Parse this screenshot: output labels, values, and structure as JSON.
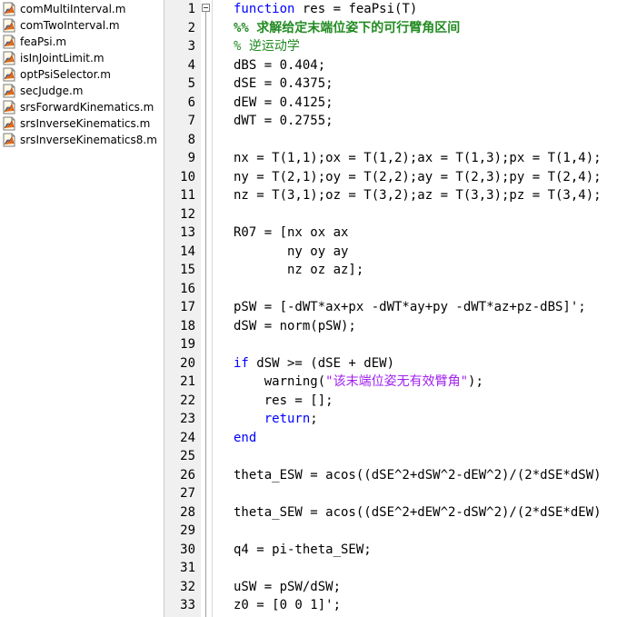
{
  "files": [
    {
      "name": "comMultiInterval.m",
      "icon": "matlab-file-icon"
    },
    {
      "name": "comTwoInterval.m",
      "icon": "matlab-file-icon"
    },
    {
      "name": "feaPsi.m",
      "icon": "matlab-file-icon"
    },
    {
      "name": "isInJointLimit.m",
      "icon": "matlab-file-icon"
    },
    {
      "name": "optPsiSelector.m",
      "icon": "matlab-file-icon"
    },
    {
      "name": "secJudge.m",
      "icon": "matlab-file-icon"
    },
    {
      "name": "srsForwardKinematics.m",
      "icon": "matlab-file-icon"
    },
    {
      "name": "srsInverseKinematics.m",
      "icon": "matlab-file-icon"
    },
    {
      "name": "srsInverseKinematics8.m",
      "icon": "matlab-file-icon"
    }
  ],
  "colors": {
    "keyword": "#0000ff",
    "comment": "#228b22",
    "string": "#a020f0",
    "gutter": "#f0f0f0"
  },
  "code_lines": [
    {
      "n": "1",
      "tokens": [
        {
          "t": "function",
          "c": "kw"
        },
        {
          "t": " res = feaPsi(T)",
          "c": ""
        }
      ]
    },
    {
      "n": "2",
      "tokens": [
        {
          "t": "%% 求解给定末端位姿下的可行臂角区间",
          "c": "cmb"
        }
      ]
    },
    {
      "n": "3",
      "tokens": [
        {
          "t": "% 逆运动学",
          "c": "cm"
        }
      ]
    },
    {
      "n": "4",
      "tokens": [
        {
          "t": "dBS = 0.404;",
          "c": ""
        }
      ]
    },
    {
      "n": "5",
      "tokens": [
        {
          "t": "dSE = 0.4375;",
          "c": ""
        }
      ]
    },
    {
      "n": "6",
      "tokens": [
        {
          "t": "dEW = 0.4125;",
          "c": ""
        }
      ]
    },
    {
      "n": "7",
      "tokens": [
        {
          "t": "dWT = 0.2755;",
          "c": ""
        }
      ]
    },
    {
      "n": "8",
      "tokens": []
    },
    {
      "n": "9",
      "tokens": [
        {
          "t": "nx = T(1,1);ox = T(1,2);ax = T(1,3);px = T(1,4);",
          "c": ""
        }
      ]
    },
    {
      "n": "10",
      "tokens": [
        {
          "t": "ny = T(2,1);oy = T(2,2);ay = T(2,3);py = T(2,4);",
          "c": ""
        }
      ]
    },
    {
      "n": "11",
      "tokens": [
        {
          "t": "nz = T(3,1);oz = T(3,2);az = T(3,3);pz = T(3,4);",
          "c": ""
        }
      ]
    },
    {
      "n": "12",
      "tokens": []
    },
    {
      "n": "13",
      "tokens": [
        {
          "t": "R07 = [nx ox ax",
          "c": ""
        }
      ]
    },
    {
      "n": "14",
      "tokens": [
        {
          "t": "       ny oy ay",
          "c": ""
        }
      ]
    },
    {
      "n": "15",
      "tokens": [
        {
          "t": "       nz oz az];",
          "c": ""
        }
      ]
    },
    {
      "n": "16",
      "tokens": []
    },
    {
      "n": "17",
      "tokens": [
        {
          "t": "pSW = [-dWT*ax+px -dWT*ay+py -dWT*az+pz-dBS]';",
          "c": ""
        }
      ]
    },
    {
      "n": "18",
      "tokens": [
        {
          "t": "dSW = norm(pSW);",
          "c": ""
        }
      ]
    },
    {
      "n": "19",
      "tokens": []
    },
    {
      "n": "20",
      "tokens": [
        {
          "t": "if",
          "c": "kw"
        },
        {
          "t": " dSW >= (dSE + dEW)",
          "c": ""
        }
      ]
    },
    {
      "n": "21",
      "tokens": [
        {
          "t": "    warning(",
          "c": ""
        },
        {
          "t": "\"该末端位姿无有效臂角\"",
          "c": "st"
        },
        {
          "t": ");",
          "c": ""
        }
      ]
    },
    {
      "n": "22",
      "tokens": [
        {
          "t": "    res = [];",
          "c": ""
        }
      ]
    },
    {
      "n": "23",
      "tokens": [
        {
          "t": "    ",
          "c": ""
        },
        {
          "t": "return",
          "c": "kw"
        },
        {
          "t": ";",
          "c": ""
        }
      ]
    },
    {
      "n": "24",
      "tokens": [
        {
          "t": "end",
          "c": "kw"
        }
      ]
    },
    {
      "n": "25",
      "tokens": []
    },
    {
      "n": "26",
      "tokens": [
        {
          "t": "theta_ESW = acos((dSE^2+dSW^2-dEW^2)/(2*dSE*dSW)",
          "c": ""
        }
      ]
    },
    {
      "n": "27",
      "tokens": []
    },
    {
      "n": "28",
      "tokens": [
        {
          "t": "theta_SEW = acos((dSE^2+dEW^2-dSW^2)/(2*dSE*dEW)",
          "c": ""
        }
      ]
    },
    {
      "n": "29",
      "tokens": []
    },
    {
      "n": "30",
      "tokens": [
        {
          "t": "q4 = pi-theta_SEW;",
          "c": ""
        }
      ]
    },
    {
      "n": "31",
      "tokens": []
    },
    {
      "n": "32",
      "tokens": [
        {
          "t": "uSW = pSW/dSW;",
          "c": ""
        }
      ]
    },
    {
      "n": "33",
      "tokens": [
        {
          "t": "z0 = [0 0 1]';",
          "c": ""
        }
      ]
    }
  ]
}
